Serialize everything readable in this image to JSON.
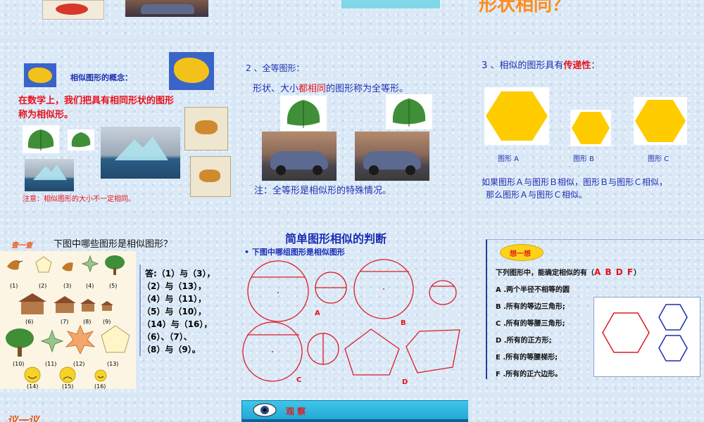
{
  "top_right": {
    "partial_title": "形状相同？"
  },
  "slide_concept": {
    "title": "相似图形的概念：",
    "definition_line1": "在数学上，我们把具有相同形状的图形",
    "definition_line2": "称为相似形。",
    "note": "注意：相似图形的大小不一定相同。"
  },
  "slide_congruent": {
    "heading": "2 、全等图形：",
    "def_prefix": "形状、大小",
    "def_emphasis": "都相同",
    "def_suffix": "的图形称为全等形。",
    "note": "注：全等形是相似形的特殊情况。"
  },
  "slide_transitive": {
    "heading_prefix": "3 、相似的图形具有",
    "heading_emphasis": "传递性",
    "heading_suffix": "：",
    "labels": [
      "图形 A",
      "图形 B",
      "图形 C"
    ],
    "text_line1": "如果图形Ａ与图形Ｂ相似，图形Ｂ与图形Ｃ相似，",
    "text_line2": "那么图形Ａ与图形Ｃ相似。",
    "colors": {
      "hexagon": "#ffcc00"
    }
  },
  "slide_check": {
    "badge": "查一查",
    "question": "下图中哪些图形是相似图形？",
    "numbers_row1": [
      "(1)",
      "(2)",
      "(3)",
      "(4)",
      "(5)"
    ],
    "numbers_row2": [
      "(6)",
      "(7)",
      "(8)",
      "(9)"
    ],
    "numbers_row3": [
      "(10)",
      "(11)",
      "(12)",
      "(13)"
    ],
    "numbers_row4": [
      "(14)",
      "(15)",
      "(16)"
    ],
    "answer_lines": [
      "答:（1）与（3），",
      "（2）与（13），",
      "（4）与（11），",
      "（5）与（10），",
      "（14）与（16），",
      "（6）、（7）、",
      "（8）与（9）。"
    ]
  },
  "slide_judge": {
    "title": "简单图形相似的判断",
    "bullet": "• 下图中哪组图形是相似图形",
    "labels": [
      "A",
      "B",
      "C",
      "D"
    ]
  },
  "slide_think": {
    "badge": "想一想",
    "question_prefix": "下列图形中，能确定相似的有（",
    "answer": "A B D F",
    "question_suffix": "）",
    "options": [
      "A .两个半径不相等的圆",
      "B .所有的等边三角形;",
      "C .所有的等腰三角形;",
      "D .所有的正方形;",
      "E .所有的等腰梯形;",
      "F .所有的正六边形。"
    ]
  },
  "bottom_left": {
    "partial_badge": "议一议"
  },
  "bottom_mid": {
    "banner": "观 察"
  }
}
